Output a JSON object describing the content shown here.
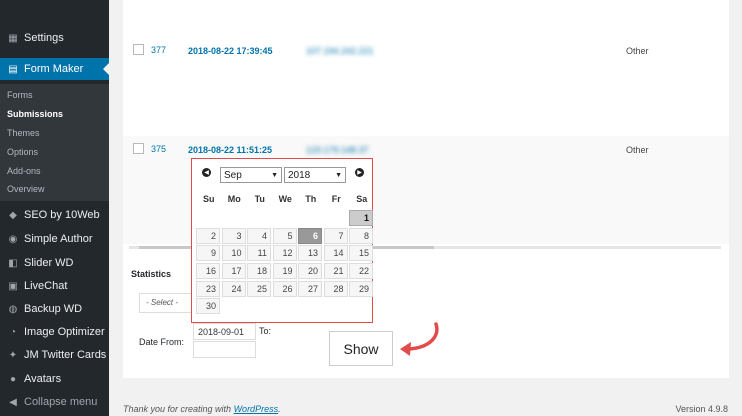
{
  "sidebar": {
    "items": [
      {
        "label": "Settings",
        "icon": "settings-icon"
      },
      {
        "label": "Form Maker",
        "icon": "form-icon"
      },
      {
        "label": "SEO by 10Web",
        "icon": "seo-icon"
      },
      {
        "label": "Simple Author",
        "icon": "author-icon"
      },
      {
        "label": "Slider WD",
        "icon": "slider-icon"
      },
      {
        "label": "LiveChat",
        "icon": "chat-icon"
      },
      {
        "label": "Backup WD",
        "icon": "backup-icon"
      },
      {
        "label": "Image Optimizer",
        "icon": "image-icon"
      },
      {
        "label": "JM Twitter Cards",
        "icon": "twitter-icon"
      },
      {
        "label": "Avatars",
        "icon": "avatar-icon"
      },
      {
        "label": "Collapse menu",
        "icon": "collapse-icon"
      }
    ],
    "submenu": [
      "Forms",
      "Submissions",
      "Themes",
      "Options",
      "Add-ons",
      "Overview"
    ]
  },
  "table": {
    "rows": [
      {
        "id": "377",
        "date": "2018-08-22 17:39:45",
        "ip": "107.194.242.221",
        "country": "Other"
      },
      {
        "id": "375",
        "date": "2018-08-22 11:51:25",
        "ip": "123.179.148.37",
        "country": "Other"
      }
    ]
  },
  "stats": {
    "title": "Statistics",
    "select_placeholder": "- Select -",
    "date_from_label": "Date From:",
    "date_from_value": "2018-09-01",
    "to_label": "To:",
    "show_label": "Show"
  },
  "datepicker": {
    "month": "Sep",
    "year": "2018",
    "weekdays": [
      "Su",
      "Mo",
      "Tu",
      "We",
      "Th",
      "Fr",
      "Sa"
    ],
    "weeks": [
      [
        "",
        "",
        "",
        "",
        "",
        "",
        "1"
      ],
      [
        "2",
        "3",
        "4",
        "5",
        "6",
        "7",
        "8"
      ],
      [
        "9",
        "10",
        "11",
        "12",
        "13",
        "14",
        "15"
      ],
      [
        "16",
        "17",
        "18",
        "19",
        "20",
        "21",
        "22"
      ],
      [
        "23",
        "24",
        "25",
        "26",
        "27",
        "28",
        "29"
      ],
      [
        "30",
        "",
        "",
        "",
        "",
        "",
        ""
      ]
    ],
    "selected": "1",
    "today": "6"
  },
  "footer": {
    "thanks_prefix": "Thank you for creating with ",
    "thanks_link": "WordPress",
    "thanks_suffix": ".",
    "version": "Version 4.9.8"
  },
  "colors": {
    "accent": "#0073aa",
    "sidebar": "#23282d",
    "highlight": "#e04b4b"
  }
}
